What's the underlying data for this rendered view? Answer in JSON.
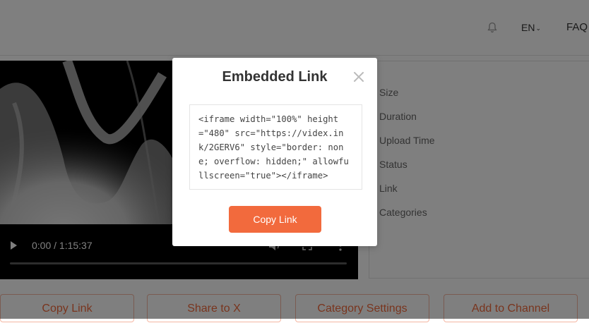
{
  "header": {
    "language": "EN",
    "faq": "FAQ"
  },
  "video": {
    "time": "0:00 / 1:15:37",
    "progress": 0
  },
  "info_labels": [
    "Size",
    "Duration",
    "Upload Time",
    "Status",
    "Link",
    "Categories"
  ],
  "actions": [
    "Copy Link",
    "Share to X",
    "Category Settings",
    "Add to Channel"
  ],
  "modal": {
    "title": "Embedded Link",
    "embed_code": "<iframe width=\"100%\" height=\"480\" src=\"https://videx.ink/2GERV6\" style=\"border: none; overflow: hidden;\" allowfullscreen=\"true\"></iframe>",
    "copy_button": "Copy Link"
  },
  "colors": {
    "accent": "#f26a3d",
    "overlay": "rgba(0,0,0,0.5)"
  },
  "icons": [
    "bell-icon",
    "chevron-down-icon",
    "play-icon",
    "volume-icon",
    "fullscreen-icon",
    "more-vertical-icon",
    "close-icon"
  ]
}
